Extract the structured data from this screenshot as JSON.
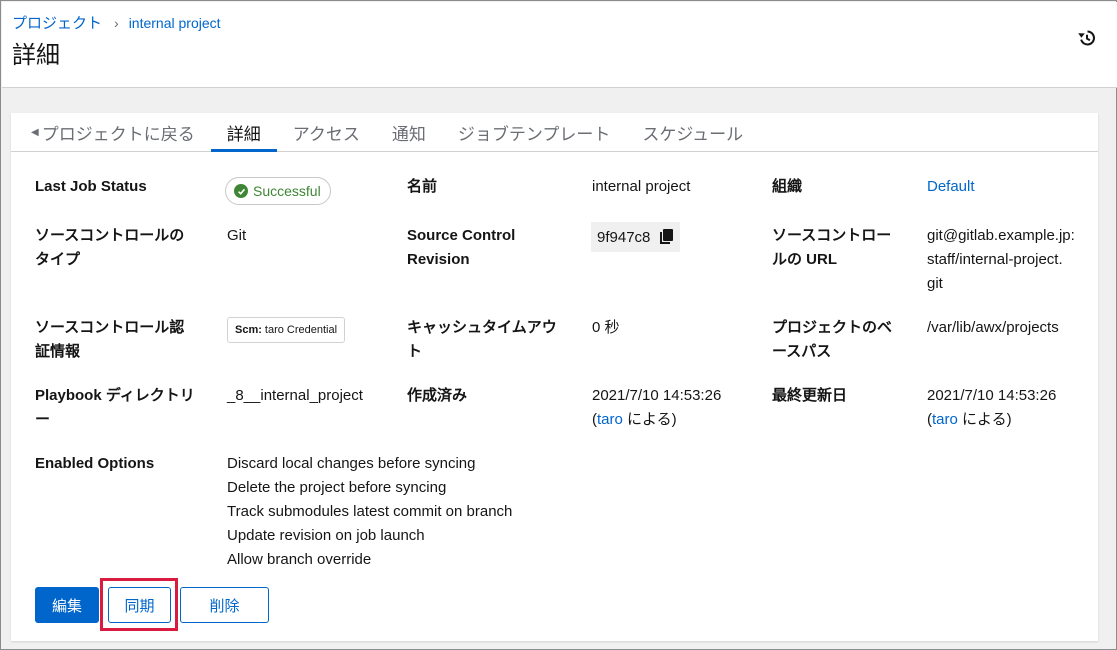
{
  "breadcrumb": {
    "parent": "プロジェクト",
    "current": "internal project"
  },
  "page_title": "詳細",
  "icons": {
    "history": "history-icon",
    "copy": "copy-icon",
    "check": "check-circle-icon",
    "back": "caret-left-icon"
  },
  "tabs": [
    {
      "label": "プロジェクトに戻る",
      "active": false
    },
    {
      "label": "詳細",
      "active": true
    },
    {
      "label": "アクセス",
      "active": false
    },
    {
      "label": "通知",
      "active": false
    },
    {
      "label": "ジョブテンプレート",
      "active": false
    },
    {
      "label": "スケジュール",
      "active": false
    }
  ],
  "details": {
    "last_job_status": {
      "label": "Last Job Status",
      "value": "Successful"
    },
    "name": {
      "label": "名前",
      "value": "internal project"
    },
    "organization": {
      "label": "組織",
      "value": "Default"
    },
    "scm_type": {
      "label_line1": "ソースコントロールの",
      "label_line2": "タイプ",
      "value": "Git"
    },
    "scm_revision": {
      "label_line1": "Source Control",
      "label_line2": "Revision",
      "value": "9f947c8"
    },
    "scm_url": {
      "label_line1": "ソースコントロー",
      "label_line2": "ルの URL",
      "value_line1": "git@gitlab.example.jp:",
      "value_line2": "staff/internal-project.",
      "value_line3": "git"
    },
    "scm_credential": {
      "label_line1": "ソースコントロール認",
      "label_line2": "証情報",
      "prefix": "Scm:",
      "value": "taro Credential"
    },
    "cache_timeout": {
      "label_line1": "キャッシュタイムアウ",
      "label_line2": "ト",
      "value": "0 秒"
    },
    "base_path": {
      "label_line1": "プロジェクトのベ",
      "label_line2": "ースパス",
      "value": "/var/lib/awx/projects"
    },
    "playbook_dir": {
      "label_line1": "Playbook ディレクトリ",
      "label_line2": "ー",
      "value": "_8__internal_project"
    },
    "created": {
      "label": "作成済み",
      "date": "2021/7/10 14:53:26",
      "open": "(",
      "user": "taro",
      "close": " による)"
    },
    "modified": {
      "label": "最終更新日",
      "date": "2021/7/10 14:53:26",
      "open": "(",
      "user": "taro",
      "close": " による)"
    },
    "enabled_options": {
      "label": "Enabled Options",
      "items": [
        "Discard local changes before syncing",
        "Delete the project before syncing",
        "Track submodules latest commit on branch",
        "Update revision on job launch",
        "Allow branch override"
      ]
    }
  },
  "buttons": {
    "edit": "編集",
    "sync": "同期",
    "delete": "削除"
  },
  "colors": {
    "accent": "#0066cc",
    "success": "#3e8635",
    "highlight": "#d81b3f"
  }
}
